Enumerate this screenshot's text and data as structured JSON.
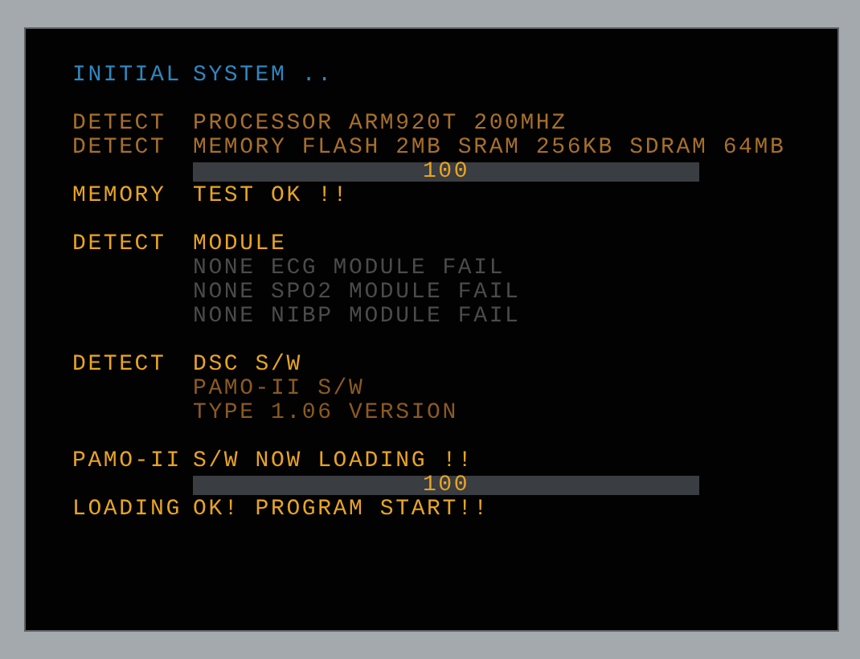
{
  "groups": [
    {
      "lines": [
        {
          "kind": "text",
          "color": "#2f86c0",
          "label": "INITIAL",
          "text": "SYSTEM .."
        }
      ]
    },
    {
      "lines": [
        {
          "kind": "text",
          "color": "#a86f2c",
          "label": "DETECT",
          "text": "PROCESSOR  ARM920T 200MHZ"
        },
        {
          "kind": "text",
          "color": "#a86f2c",
          "label": "DETECT",
          "text": "MEMORY FLASH 2MB SRAM 256KB SDRAM 64MB"
        },
        {
          "kind": "progress",
          "level": 1,
          "reading": "100"
        },
        {
          "kind": "text",
          "color": "#e8a423",
          "label": "MEMORY",
          "text": "TEST OK !!"
        }
      ]
    },
    {
      "lines": [
        {
          "kind": "text",
          "color": "#e8a423",
          "label": "DETECT",
          "text": "MODULE"
        },
        {
          "kind": "text",
          "color": "#4b4b4b",
          "text": "NONE ECG MODULE FAIL"
        },
        {
          "kind": "text",
          "color": "#4b4b4b",
          "text": "NONE SPO2 MODULE FAIL"
        },
        {
          "kind": "text",
          "color": "#4b4b4b",
          "text": "NONE NIBP MODULE FAIL"
        }
      ]
    },
    {
      "lines": [
        {
          "kind": "text",
          "color": "#e8a423",
          "label": "DETECT",
          "text": "DSC S/W"
        },
        {
          "kind": "text",
          "color": "#8c5a22",
          "text": "PAMO-II S/W"
        },
        {
          "kind": "text",
          "color": "#8c5a22",
          "text": "TYPE 1.06 VERSION"
        }
      ]
    },
    {
      "lines": [
        {
          "kind": "text",
          "color": "#e8a423",
          "label": "PAMO-II",
          "text": "S/W NOW LOADING !!"
        },
        {
          "kind": "progress",
          "level": 1,
          "reading": "100"
        },
        {
          "kind": "text",
          "color": "#e8a423",
          "label": "LOADING",
          "text": "OK! PROGRAM START!!"
        }
      ]
    }
  ]
}
